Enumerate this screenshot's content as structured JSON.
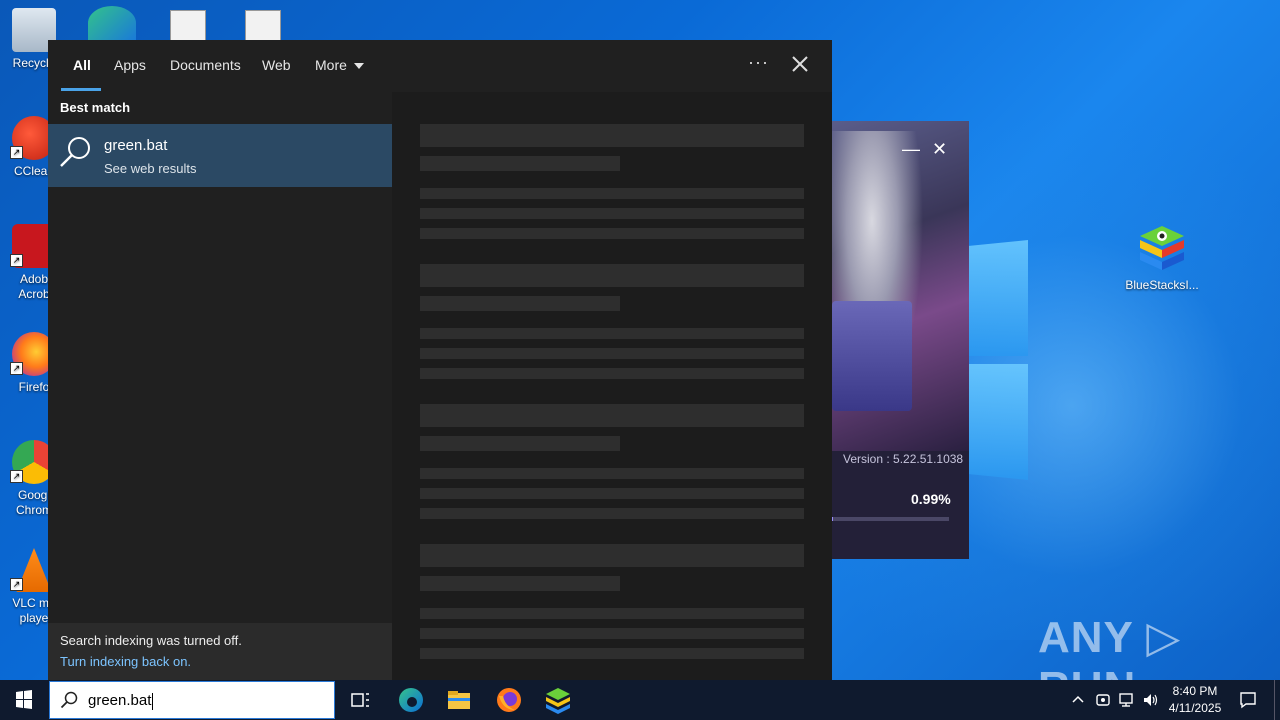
{
  "desktop": {
    "icons": [
      {
        "label": "Recycle"
      },
      {
        "label": "CClean"
      },
      {
        "label": "Adob\nAcrob"
      },
      {
        "label": "Firefo"
      },
      {
        "label": "Googl\nChrom"
      },
      {
        "label": "VLC me\nplaye"
      }
    ],
    "bluestacks_icon_label": "BlueStacksI...",
    "watermark": "ANY ▷ RUN"
  },
  "installer": {
    "version": "Version : 5.22.51.1038",
    "progress_text": "0.99%",
    "progress_value": 0.0099,
    "minimize_glyph": "—",
    "close_glyph": "✕"
  },
  "search": {
    "tabs": [
      {
        "label": "All",
        "active": true
      },
      {
        "label": "Apps"
      },
      {
        "label": "Documents"
      },
      {
        "label": "Web"
      },
      {
        "label": "More"
      }
    ],
    "options_glyph": "···",
    "section_title": "Best match",
    "best_match": {
      "title": "green.bat",
      "subtitle": "See web results"
    },
    "indexing": {
      "message": "Search indexing was turned off.",
      "link": "Turn indexing back on."
    }
  },
  "taskbar": {
    "search_value": "green.bat",
    "clock_time": "8:40 PM",
    "clock_date": "4/11/2025"
  },
  "colors": {
    "accent": "#4aa3e8",
    "best_match_bg": "#2b4964",
    "link": "#7cc4ff"
  }
}
